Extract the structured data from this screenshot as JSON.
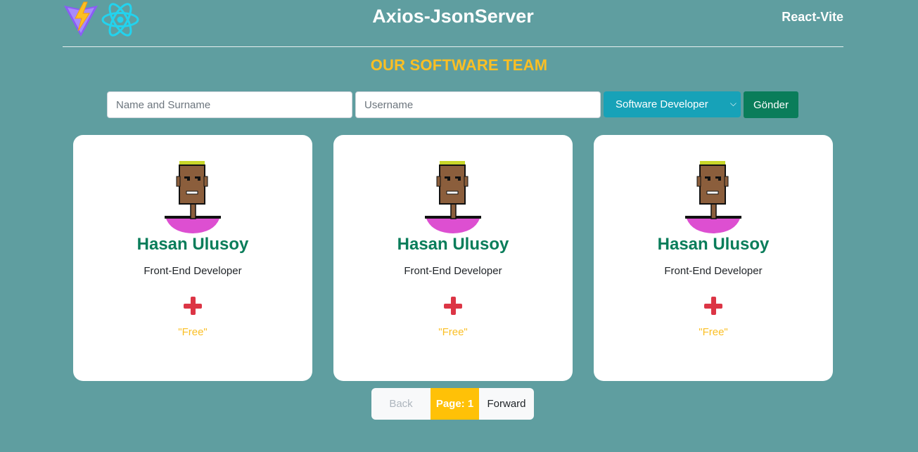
{
  "header": {
    "title": "Axios-JsonServer",
    "brand": "React-Vite",
    "logos": [
      "vite-logo",
      "react-logo"
    ]
  },
  "section_title": "OUR SOFTWARE TEAM",
  "form": {
    "name_placeholder": "Name and Surname",
    "username_placeholder": "Username",
    "role_selected": "Software Developer",
    "submit_label": "Gönder"
  },
  "cards": [
    {
      "name": "Hasan Ulusoy",
      "role": "Front-End Developer",
      "status": "\"Free\"",
      "action_icon": "plus-icon"
    },
    {
      "name": "Hasan Ulusoy",
      "role": "Front-End Developer",
      "status": "\"Free\"",
      "action_icon": "plus-icon"
    },
    {
      "name": "Hasan Ulusoy",
      "role": "Front-End Developer",
      "status": "\"Free\"",
      "action_icon": "plus-icon"
    }
  ],
  "pagination": {
    "back_label": "Back",
    "page_label": "Page: 1",
    "forward_label": "Forward"
  },
  "colors": {
    "background": "#5f9ea0",
    "accent": "#fbbf24",
    "name_green": "#0a7d5a",
    "select_teal": "#17a2b8",
    "plus_red": "#dc3545"
  }
}
